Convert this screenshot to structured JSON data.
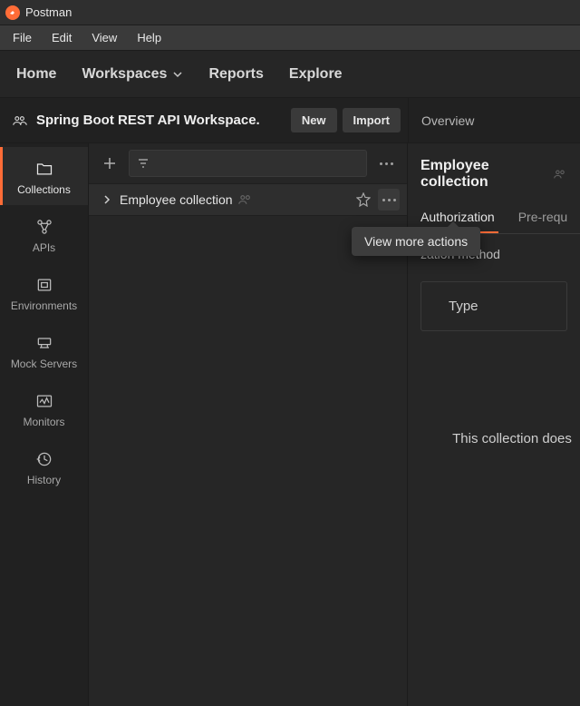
{
  "app": {
    "title": "Postman"
  },
  "menubar": [
    "File",
    "Edit",
    "View",
    "Help"
  ],
  "topnav": {
    "home": "Home",
    "workspaces": "Workspaces",
    "reports": "Reports",
    "explore": "Explore"
  },
  "workspace": {
    "name": "Spring Boot REST API Workspace.",
    "new_label": "New",
    "import_label": "Import",
    "overview_label": "Overview"
  },
  "sidebar": {
    "items": [
      {
        "label": "Collections",
        "icon": "folder-icon",
        "active": true
      },
      {
        "label": "APIs",
        "icon": "apis-icon",
        "active": false
      },
      {
        "label": "Environments",
        "icon": "env-icon",
        "active": false
      },
      {
        "label": "Mock Servers",
        "icon": "mock-icon",
        "active": false
      },
      {
        "label": "Monitors",
        "icon": "monitor-icon",
        "active": false
      },
      {
        "label": "History",
        "icon": "history-icon",
        "active": false
      }
    ]
  },
  "collections": {
    "items": [
      {
        "name": "Employee collection"
      }
    ],
    "tooltip": "View more actions"
  },
  "detail": {
    "title": "Employee collection",
    "tabs": [
      {
        "label": "Authorization",
        "active": true
      },
      {
        "label": "Pre-requ",
        "active": false
      }
    ],
    "auth_text_fragment": "zation method",
    "type_label": "Type",
    "empty_text": "This collection does"
  }
}
